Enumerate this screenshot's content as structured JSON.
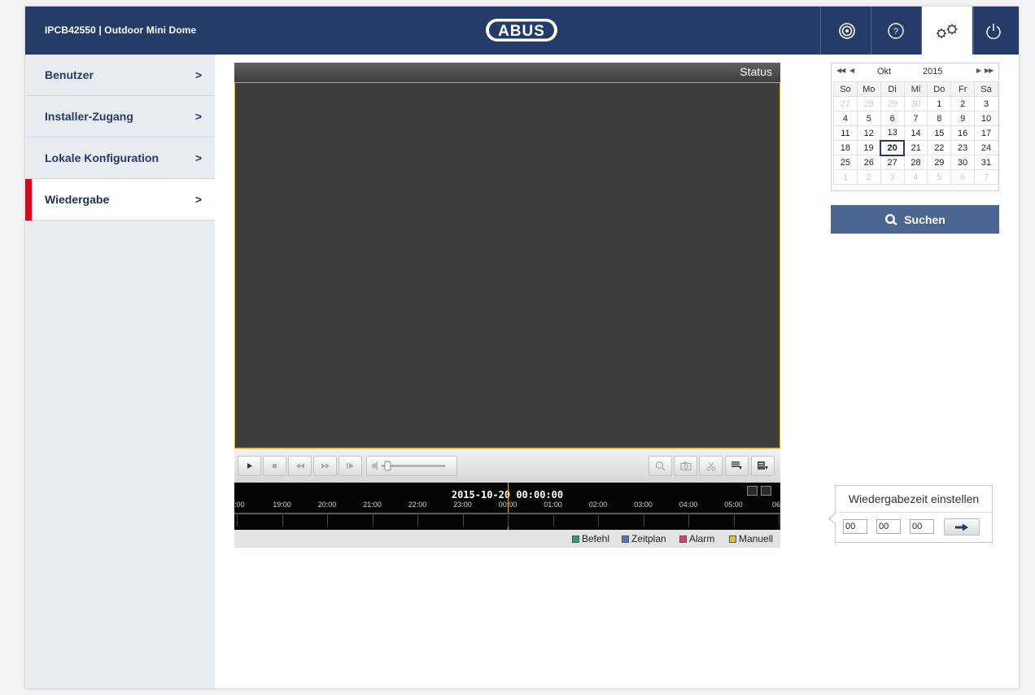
{
  "header": {
    "device_title": "IPCB42550 | Outdoor Mini Dome",
    "logo_text": "ABUS",
    "icons": [
      "live-view-icon",
      "help-icon",
      "settings-icon",
      "power-icon"
    ]
  },
  "sidebar": {
    "items": [
      {
        "label": "Benutzer",
        "arrow": ">"
      },
      {
        "label": "Installer-Zugang",
        "arrow": ">"
      },
      {
        "label": "Lokale Konfiguration",
        "arrow": ">"
      },
      {
        "label": "Wiedergabe",
        "arrow": ">"
      }
    ],
    "active_index": 3
  },
  "player": {
    "status_label": "Status",
    "volume_level": 0.05,
    "timeline": {
      "datetime": "2015-10-20 00:00:00",
      "tick_labels": [
        ":00",
        "19:00",
        "20:00",
        "21:00",
        "22:00",
        "23:00",
        "00:00",
        "01:00",
        "02:00",
        "03:00",
        "04:00",
        "05:00",
        "06:"
      ]
    },
    "legend": [
      {
        "label": "Befehl",
        "color": "#2f9e6e"
      },
      {
        "label": "Zeitplan",
        "color": "#5a6fd4"
      },
      {
        "label": "Alarm",
        "color": "#d9406a"
      },
      {
        "label": "Manuell",
        "color": "#e9c225"
      }
    ]
  },
  "calendar": {
    "month": "Okt",
    "year": "2015",
    "weekdays": [
      "So",
      "Mo",
      "Di",
      "Mi",
      "Do",
      "Fr",
      "Sa"
    ],
    "weeks": [
      [
        "27",
        "28",
        "29",
        "30",
        "1",
        "2",
        "3"
      ],
      [
        "4",
        "5",
        "6",
        "7",
        "8",
        "9",
        "10"
      ],
      [
        "11",
        "12",
        "13",
        "14",
        "15",
        "16",
        "17"
      ],
      [
        "18",
        "19",
        "20",
        "21",
        "22",
        "23",
        "24"
      ],
      [
        "25",
        "26",
        "27",
        "28",
        "29",
        "30",
        "31"
      ],
      [
        "1",
        "2",
        "3",
        "4",
        "5",
        "6",
        "7"
      ]
    ],
    "selected_day": "20"
  },
  "search": {
    "label": "Suchen"
  },
  "playback_time": {
    "title": "Wiedergabezeit einstellen",
    "hour": "00",
    "minute": "00",
    "second": "00"
  },
  "colors": {
    "header_bg": "#253c69",
    "accent_red": "#e2001a",
    "search_bg": "#4b6690",
    "timeline_cursor": "#e3b23c"
  }
}
